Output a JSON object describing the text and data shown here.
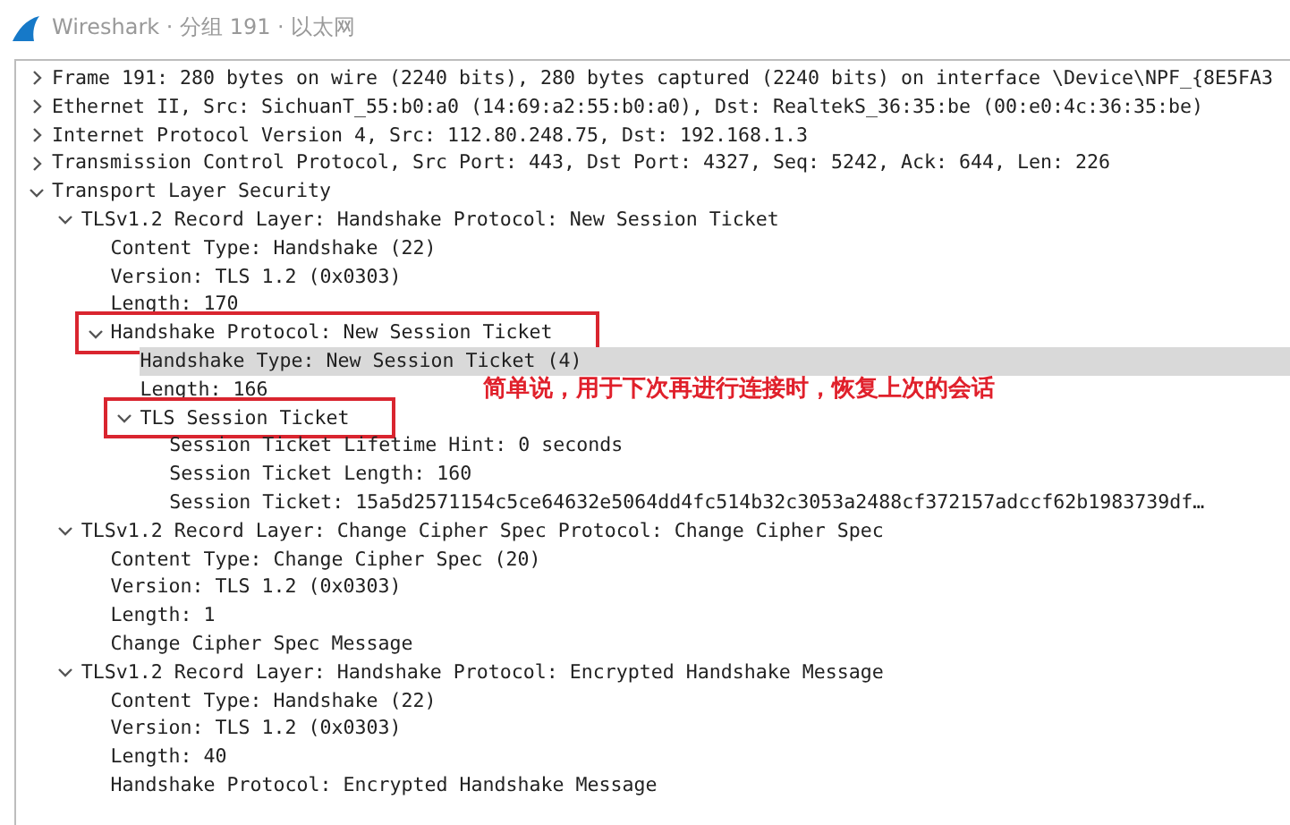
{
  "window": {
    "title": "Wireshark · 分组 191 · 以太网"
  },
  "tree": [
    {
      "text": "Frame 191: 280 bytes on wire (2240 bits), 280 bytes captured (2240 bits) on interface \\Device\\NPF_{8E5FA3",
      "expanded": false,
      "selected": false,
      "boxed": false
    },
    {
      "text": "Ethernet II, Src: SichuanT_55:b0:a0 (14:69:a2:55:b0:a0), Dst: RealtekS_36:35:be (00:e0:4c:36:35:be)",
      "expanded": false,
      "selected": false,
      "boxed": false
    },
    {
      "text": "Internet Protocol Version 4, Src: 112.80.248.75, Dst: 192.168.1.3",
      "expanded": false,
      "selected": false,
      "boxed": false
    },
    {
      "text": "Transmission Control Protocol, Src Port: 443, Dst Port: 4327, Seq: 5242, Ack: 644, Len: 226",
      "expanded": false,
      "selected": false,
      "boxed": false
    },
    {
      "text": "Transport Layer Security",
      "expanded": true,
      "selected": false,
      "boxed": false,
      "children": [
        {
          "text": "TLSv1.2 Record Layer: Handshake Protocol: New Session Ticket",
          "expanded": true,
          "selected": false,
          "boxed": false,
          "children": [
            {
              "text": "Content Type: Handshake (22)",
              "selected": false,
              "boxed": false
            },
            {
              "text": "Version: TLS 1.2 (0x0303)",
              "selected": false,
              "boxed": false
            },
            {
              "text": "Length: 170",
              "selected": false,
              "boxed": false
            },
            {
              "text": "Handshake Protocol: New Session Ticket",
              "expanded": true,
              "selected": false,
              "boxed": true,
              "children": [
                {
                  "text": "Handshake Type: New Session Ticket (4)",
                  "selected": true,
                  "boxed": false
                },
                {
                  "text": "Length: 166",
                  "selected": false,
                  "boxed": false
                },
                {
                  "text": "TLS Session Ticket",
                  "expanded": true,
                  "selected": false,
                  "boxed": true,
                  "children": [
                    {
                      "text": "Session Ticket Lifetime Hint: 0 seconds",
                      "selected": false,
                      "boxed": false
                    },
                    {
                      "text": "Session Ticket Length: 160",
                      "selected": false,
                      "boxed": false
                    },
                    {
                      "text": "Session Ticket: 15a5d2571154c5ce64632e5064dd4fc514b32c3053a2488cf372157adccf62b1983739df…",
                      "selected": false,
                      "boxed": false
                    }
                  ]
                }
              ]
            }
          ]
        },
        {
          "text": "TLSv1.2 Record Layer: Change Cipher Spec Protocol: Change Cipher Spec",
          "expanded": true,
          "selected": false,
          "boxed": false,
          "children": [
            {
              "text": "Content Type: Change Cipher Spec (20)",
              "selected": false,
              "boxed": false
            },
            {
              "text": "Version: TLS 1.2 (0x0303)",
              "selected": false,
              "boxed": false
            },
            {
              "text": "Length: 1",
              "selected": false,
              "boxed": false
            },
            {
              "text": "Change Cipher Spec Message",
              "selected": false,
              "boxed": false
            }
          ]
        },
        {
          "text": "TLSv1.2 Record Layer: Handshake Protocol: Encrypted Handshake Message",
          "expanded": true,
          "selected": false,
          "boxed": false,
          "children": [
            {
              "text": "Content Type: Handshake (22)",
              "selected": false,
              "boxed": false
            },
            {
              "text": "Version: TLS 1.2 (0x0303)",
              "selected": false,
              "boxed": false
            },
            {
              "text": "Length: 40",
              "selected": false,
              "boxed": false
            },
            {
              "text": "Handshake Protocol: Encrypted Handshake Message",
              "selected": false,
              "boxed": false
            }
          ]
        }
      ]
    }
  ],
  "annotation": {
    "text": "简单说，用于下次再进行连接时，恢复上次的会话"
  }
}
